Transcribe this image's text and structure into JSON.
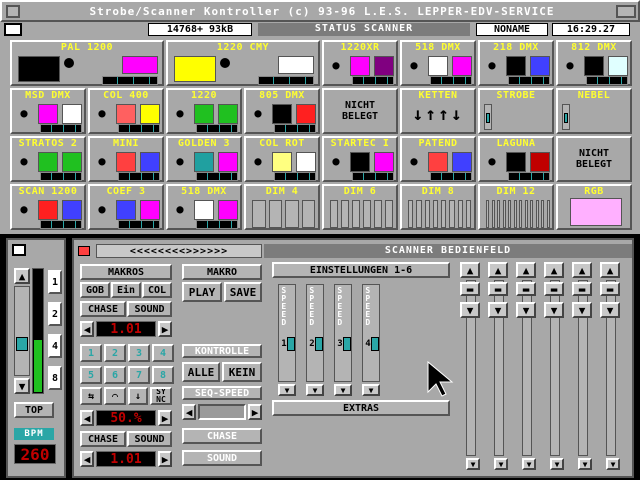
{
  "title_bar": {
    "title": "Strobe/Scanner Kontroller (c) 93-96 L.E.S. LEPPER-EDV-SERVICE"
  },
  "status_bar": {
    "memory": "14768+  93kB",
    "status": "STATUS SCANNER",
    "name": "NONAME",
    "time": "16:29.27"
  },
  "devices": [
    [
      {
        "label": "PAL 1200",
        "type": "device",
        "swatches": [
          "#000000",
          "#ff00ff"
        ]
      },
      {
        "label": "1220 CMY",
        "type": "device",
        "swatches": [
          "#ffff00",
          "#ffffff"
        ]
      },
      {
        "label": "1220XR",
        "type": "device",
        "swatches": [
          "#ff00ff",
          "#800080"
        ]
      },
      {
        "label": "518 DMX",
        "type": "device",
        "swatches": [
          "#ffffff",
          "#ff00ff"
        ]
      },
      {
        "label": "218 DMX",
        "type": "device",
        "swatches": [
          "#000000",
          "#4040ff"
        ]
      },
      {
        "label": "812 DMX",
        "type": "device",
        "swatches": [
          "#000000",
          "#e0ffff"
        ]
      }
    ],
    [
      {
        "label": "MSD DMX",
        "type": "device",
        "swatches": [
          "#ff00ff",
          "#ffffff"
        ]
      },
      {
        "label": "COL 400",
        "type": "device",
        "swatches": [
          "#ff6060",
          "#ffff00"
        ]
      },
      {
        "label": "1220",
        "type": "device",
        "swatches": [
          "#20c020",
          "#20c020"
        ]
      },
      {
        "label": "805 DMX",
        "type": "device",
        "swatches": [
          "#000000",
          "#ff2020"
        ]
      },
      {
        "label": "NICHT BELEGT",
        "type": "empty"
      },
      {
        "label": "KETTEN",
        "type": "chain"
      },
      {
        "label": "STROBE",
        "type": "single"
      },
      {
        "label": "NEBEL",
        "type": "single"
      }
    ],
    [
      {
        "label": "STRATOS 2",
        "type": "device",
        "swatches": [
          "#20c020",
          "#20c020"
        ]
      },
      {
        "label": "MINI",
        "type": "device",
        "swatches": [
          "#ff4040",
          "#4040ff"
        ]
      },
      {
        "label": "GOLDEN 3",
        "type": "device",
        "swatches": [
          "#20a0a0",
          "#ff00ff"
        ]
      },
      {
        "label": "COL ROT",
        "type": "device",
        "swatches": [
          "#ffff80",
          "#ffffff"
        ]
      },
      {
        "label": "STARTEC I",
        "type": "device",
        "swatches": [
          "#000000",
          "#ff00ff"
        ]
      },
      {
        "label": "PATEND",
        "type": "device",
        "swatches": [
          "#ff4040",
          "#4040ff"
        ]
      },
      {
        "label": "LAGUNA",
        "type": "device",
        "swatches": [
          "#000000",
          "#c00000"
        ]
      },
      {
        "label": "NICHT BELEGT",
        "type": "empty"
      }
    ],
    [
      {
        "label": "SCAN 1200",
        "type": "device",
        "swatches": [
          "#ff2020",
          "#4040ff"
        ]
      },
      {
        "label": "COEF 3",
        "type": "device",
        "swatches": [
          "#4040ff",
          "#ff00ff"
        ]
      },
      {
        "label": "518 DMX",
        "type": "device",
        "swatches": [
          "#ffffff",
          "#ff00ff"
        ]
      },
      {
        "label": "DIM 4",
        "type": "dim",
        "bars": 4
      },
      {
        "label": "DIM 6",
        "type": "dim",
        "bars": 6
      },
      {
        "label": "DIM 8",
        "type": "dim",
        "bars": 8
      },
      {
        "label": "DIM 12",
        "type": "dim",
        "bars": 12
      },
      {
        "label": "RGB",
        "type": "rgb",
        "swatches": [
          "#ffb0ff"
        ]
      }
    ]
  ],
  "left_panel": {
    "buttons": [
      "1",
      "2",
      "4",
      "8"
    ],
    "top_label": "TOP",
    "bpm_label": "BPM",
    "bpm_value": "260"
  },
  "scanner_panel": {
    "header_arrows": "<<<<<<<<>>>>>>",
    "title": "SCANNER BEDIENFELD",
    "makros_label": "MAKROS",
    "makro_label": "MAKRO",
    "gob": "GOB",
    "ein": "Ein",
    "col": "COL",
    "chase": "CHASE",
    "sound": "SOUND",
    "value1": "1.01",
    "numbers": [
      "1",
      "2",
      "3",
      "4",
      "5",
      "6",
      "7",
      "8"
    ],
    "sync": "SY NC",
    "value2": "50.%",
    "chase2": "CHASE",
    "sound2": "SOUND",
    "value3": "1.01",
    "play": "PLAY",
    "save": "SAVE",
    "kontrolle": "KONTROLLE",
    "alle": "ALLE",
    "kein": "KEIN",
    "seq_speed": "SEQ-SPEED",
    "chase3": "CHASE",
    "sound3": "SOUND",
    "einstellungen": "EINSTELLUNGEN 1-6",
    "speed_label": "SPEED",
    "speed_channels": [
      "1",
      "2",
      "3",
      "4"
    ],
    "extras": "EXTRAS"
  },
  "colors": {
    "panel": "#a8a8a8",
    "accent_yellow": "#ffff30",
    "accent_cyan": "#2aa6a6",
    "lcd_red": "#c00000"
  }
}
